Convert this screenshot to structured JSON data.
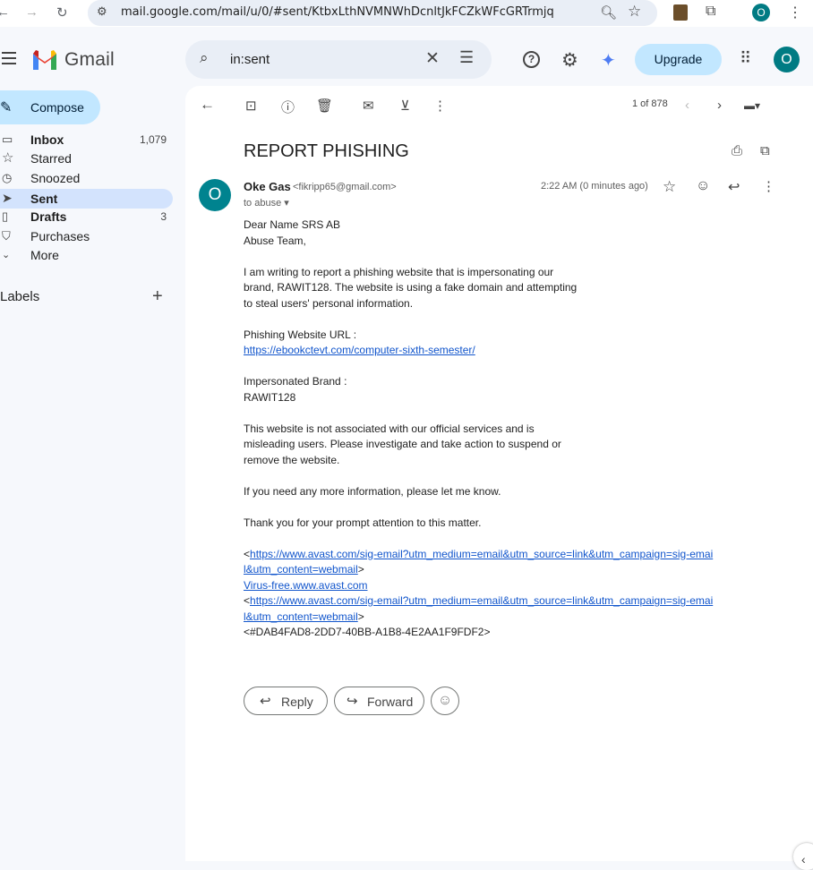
{
  "browser": {
    "url": "mail.google.com/mail/u/0/#sent/KtbxLthNVMNWhDcnltJkFCZkWFcGRTrmjq",
    "profile_initial": "O"
  },
  "header": {
    "app_name": "Gmail",
    "search_value": "in:sent",
    "upgrade_label": "Upgrade",
    "avatar_initial": "O"
  },
  "sidebar": {
    "compose_label": "Compose",
    "items": [
      {
        "label": "Inbox",
        "count": "1,079",
        "icon": "inbox-icon"
      },
      {
        "label": "Starred",
        "count": "",
        "icon": "star-icon"
      },
      {
        "label": "Snoozed",
        "count": "",
        "icon": "clock-icon"
      },
      {
        "label": "Sent",
        "count": "",
        "icon": "send-icon"
      },
      {
        "label": "Drafts",
        "count": "3",
        "icon": "draft-icon"
      },
      {
        "label": "Purchases",
        "count": "",
        "icon": "bag-icon"
      },
      {
        "label": "More",
        "count": "",
        "icon": "chevron-down-icon"
      }
    ],
    "labels_heading": "Labels"
  },
  "toolbar": {
    "pager": "1 of 878"
  },
  "email": {
    "subject": "REPORT PHISHING",
    "sender_initial": "O",
    "sender_name": "Oke Gas",
    "sender_email": "<fikripp65@gmail.com>",
    "to_line": "to abuse",
    "timestamp": "2:22 AM (0 minutes ago)",
    "body": {
      "greeting1": "Dear Name SRS AB",
      "greeting2": "Abuse Team,",
      "para1": "I am writing to report a phishing website that is impersonating our brand, RAWIT128. The website is using a fake domain and attempting to steal users' personal information.",
      "url_label": "Phishing Website URL :",
      "url_link": "https://ebookctevt.com/computer-sixth-semester/",
      "brand_label": "Impersonated Brand :",
      "brand_value": "RAWIT128",
      "para2": "This website is not associated with our official services and is misleading users. Please investigate and take action to suspend or remove the website.",
      "para3": "If you need any more information, please let me know.",
      "para4": "Thank you for your prompt attention to this matter.",
      "avast_link1": "https://www.avast.com/sig-email?utm_medium=email&utm_source=link&utm_campaign=sig-email&utm_content=webmail",
      "avast_text": "Virus-free.www.avast.com",
      "avast_link2": "https://www.avast.com/sig-email?utm_medium=email&utm_source=link&utm_campaign=sig-email&utm_content=webmail",
      "footer_id": "<#DAB4FAD8-2DD7-40BB-A1B8-4E2AA1F9FDF2>"
    },
    "reply_label": "Reply",
    "forward_label": "Forward"
  }
}
